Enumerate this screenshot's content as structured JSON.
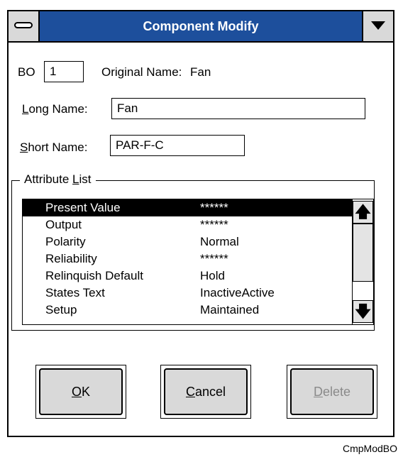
{
  "window": {
    "title": "Component Modify",
    "title_bar_color": "#1d4f9c"
  },
  "bo": {
    "label": "BO",
    "value": "1"
  },
  "original_name": {
    "label": "Original Name:",
    "value": "Fan"
  },
  "long_name": {
    "label_mnemonic": "L",
    "label_rest": "ong Name:",
    "value": "Fan"
  },
  "short_name": {
    "label_mnemonic": "S",
    "label_rest": "hort Name:",
    "value": "PAR-F-C"
  },
  "attribute_list": {
    "label_pre": "Attribute ",
    "label_mnemonic": "L",
    "label_rest": "ist",
    "rows": [
      {
        "name": "Present Value",
        "value": "******",
        "selected": true
      },
      {
        "name": "Output",
        "value": "******",
        "selected": false
      },
      {
        "name": "Polarity",
        "value": "Normal",
        "selected": false
      },
      {
        "name": "Reliability",
        "value": "******",
        "selected": false
      },
      {
        "name": "Relinquish Default",
        "value": "Hold",
        "selected": false
      },
      {
        "name": "States Text",
        "value": "InactiveActive",
        "selected": false
      },
      {
        "name": "Setup",
        "value": "Maintained",
        "selected": false
      }
    ]
  },
  "buttons": {
    "ok": {
      "mnemonic": "O",
      "rest": "K"
    },
    "cancel": {
      "mnemonic": "C",
      "rest": "ancel"
    },
    "delete": {
      "mnemonic": "D",
      "rest": "elete",
      "disabled": true
    }
  },
  "caption": "CmpModBO"
}
